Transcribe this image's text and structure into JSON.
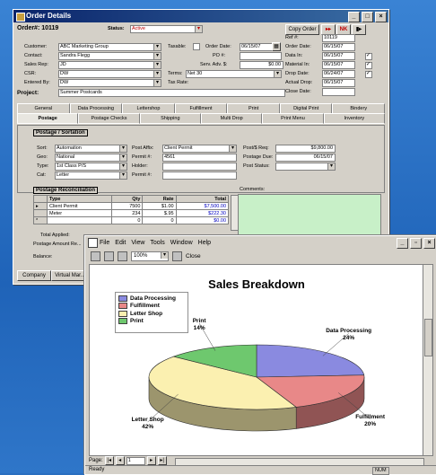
{
  "order_window": {
    "title": "Order Details",
    "order_label": "Order#:",
    "order_number": "10119",
    "status_label": "Status:",
    "status_value": "Active",
    "copy_order_btn": "Copy Order",
    "nav_buttons": [
      "▸▸",
      "NK",
      "▮▸"
    ],
    "left_fields": [
      {
        "label": "Customer:",
        "value": "ABC Marketing Group"
      },
      {
        "label": "Contact:",
        "value": "Sandra Flegg"
      },
      {
        "label": "Sales Rep:",
        "value": "JD"
      },
      {
        "label": "CSR:",
        "value": "DW"
      },
      {
        "label": "Entered By:",
        "value": "DW"
      }
    ],
    "project_label": "Project:",
    "project_value": "Summer Postcards",
    "taxable_label": "Taxable:",
    "order_date_label": "Order Date:",
    "order_date_value": "06/15/07",
    "po_label": "PO #:",
    "po_value": "",
    "serv_adv_label": "Serv. Adv. $:",
    "serv_adv_value": "$0.00",
    "terms_label": "Terms:",
    "terms_value": "Net 30",
    "tax_rate_label": "Tax Rate:",
    "right_fields": [
      {
        "label": "Ref #:",
        "value": "10119"
      },
      {
        "label": "Order Date:",
        "value": "06/15/07"
      },
      {
        "label": "Data In:",
        "value": "06/15/07"
      },
      {
        "label": "Material In:",
        "value": "06/15/07"
      },
      {
        "label": "Drop Date:",
        "value": "06/24/07"
      },
      {
        "label": "Actual Drop:",
        "value": "06/15/07"
      },
      {
        "label": "Close Date:",
        "value": ""
      }
    ],
    "tabs_row1": [
      "General",
      "Data Processing",
      "Lettershop",
      "Fulfillment",
      "Print",
      "Digital Print",
      "Bindery"
    ],
    "tabs_row2": [
      "Postage",
      "Postage Checks",
      "Shipping",
      "Multi Drop",
      "Print Menu",
      "Inventory"
    ],
    "postage_group_title": "Postage / Sortation",
    "postage_fields": [
      {
        "label": "Sort:",
        "value": "Automation"
      },
      {
        "label": "Geo:",
        "value": "National"
      },
      {
        "label": "Type:",
        "value": "1st Class P/S"
      },
      {
        "label": "Cat:",
        "value": "Letter"
      }
    ],
    "post_affix_label": "Post Affix:",
    "post_affix_value": "Client Permit",
    "permit_label": "Permit #:",
    "permit_value": "4561",
    "holder_label": "Holder:",
    "permit2_label": "Permit #:",
    "postg_req_label": "Post/$ Req:",
    "postg_req_value": "$9,800.00",
    "postage_due_label": "Postage Due:",
    "postage_due_value": "06/15/07",
    "post_status_label": "Post Status:",
    "recon_title": "Postage Reconciliation",
    "recon_headers": [
      "Type",
      "Qty",
      "Rate",
      "Total"
    ],
    "recon_rows": [
      {
        "type": "Client Permit",
        "qty": "7500",
        "rate": "$1.00",
        "total": "$7,500.00"
      },
      {
        "type": "Meter",
        "qty": "234",
        "rate": "$.95",
        "total": "$222.30"
      },
      {
        "type": "",
        "qty": "0",
        "rate": "0",
        "total": "$0.00"
      }
    ],
    "total_applied_label": "Total Applied:",
    "postage_amount_label": "Postage Amount Re...",
    "balance_label": "Balance:",
    "comments_label": "Comments:",
    "company_tab": "Company",
    "virtual_tab": "Virtual Mar..."
  },
  "report_window": {
    "menu": [
      "File",
      "Edit",
      "View",
      "Tools",
      "Window",
      "Help"
    ],
    "zoom": "100%",
    "close_label": "Close",
    "page_label": "Page:",
    "page_value": "1",
    "status_left": "Ready",
    "status_num": "NUM"
  },
  "chart_data": {
    "type": "pie",
    "title": "Sales Breakdown",
    "categories": [
      "Data Processing",
      "Fulfillment",
      "Letter Shop",
      "Print"
    ],
    "values": [
      24,
      20,
      42,
      14
    ],
    "value_labels": [
      "24%",
      "20%",
      "42%",
      "14%"
    ],
    "colors": [
      "#8a8ae0",
      "#e88888",
      "#fbf0b0",
      "#6ec86e"
    ],
    "legend_position": "top-left"
  }
}
